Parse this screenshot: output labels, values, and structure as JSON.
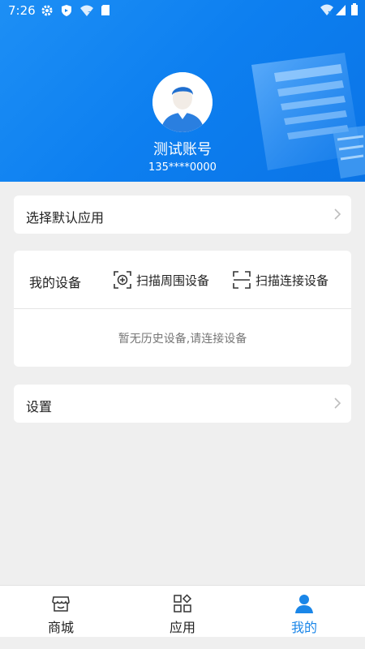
{
  "status_bar": {
    "time": "7:26"
  },
  "profile": {
    "name": "测试账号",
    "phone": "135****0000"
  },
  "menu": {
    "default_app_label": "选择默认应用",
    "settings_label": "设置"
  },
  "devices": {
    "title": "我的设备",
    "scan_nearby_label": "扫描周围设备",
    "scan_connect_label": "扫描连接设备",
    "empty_text": "暂无历史设备,请连接设备"
  },
  "tabs": [
    {
      "label": "商城",
      "icon": "store-icon",
      "active": false
    },
    {
      "label": "应用",
      "icon": "apps-grid-icon",
      "active": false
    },
    {
      "label": "我的",
      "icon": "person-icon",
      "active": true
    }
  ],
  "colors": {
    "header_blue": "#1086f2",
    "accent_blue": "#1a86e8",
    "background": "#efefef"
  }
}
